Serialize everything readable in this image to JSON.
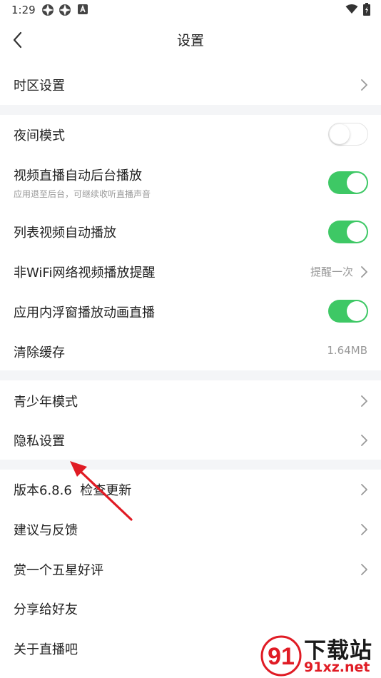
{
  "status_bar": {
    "time": "1:29"
  },
  "header": {
    "title": "设置"
  },
  "sections": {
    "s1": {
      "timezone": "时区设置"
    },
    "s2": {
      "night_mode": {
        "label": "夜间模式",
        "on": false
      },
      "video_bg_play": {
        "label": "视频直播自动后台播放",
        "sub": "应用退至后台，可继续收听直播声音",
        "on": true
      },
      "list_autoplay": {
        "label": "列表视频自动播放",
        "on": true
      },
      "non_wifi_reminder": {
        "label": "非WiFi网络视频播放提醒",
        "value": "提醒一次"
      },
      "floating_window": {
        "label": "应用内浮窗播放动画直播",
        "on": true
      },
      "clear_cache": {
        "label": "清除缓存",
        "value": "1.64MB"
      }
    },
    "s3": {
      "teen_mode": "青少年模式",
      "privacy": "隐私设置"
    },
    "s4": {
      "version": "版本6.8.6  检查更新",
      "feedback": "建议与反馈",
      "rate": "赏一个五星好评",
      "share": "分享给好友",
      "about": "关于直播吧"
    }
  },
  "watermark": {
    "title": "下载站",
    "domain": "91xz.net"
  },
  "colors": {
    "toggle_on": "#3ec865",
    "section_gap": "#f4f5f7",
    "annotation_arrow": "#e01b24"
  }
}
